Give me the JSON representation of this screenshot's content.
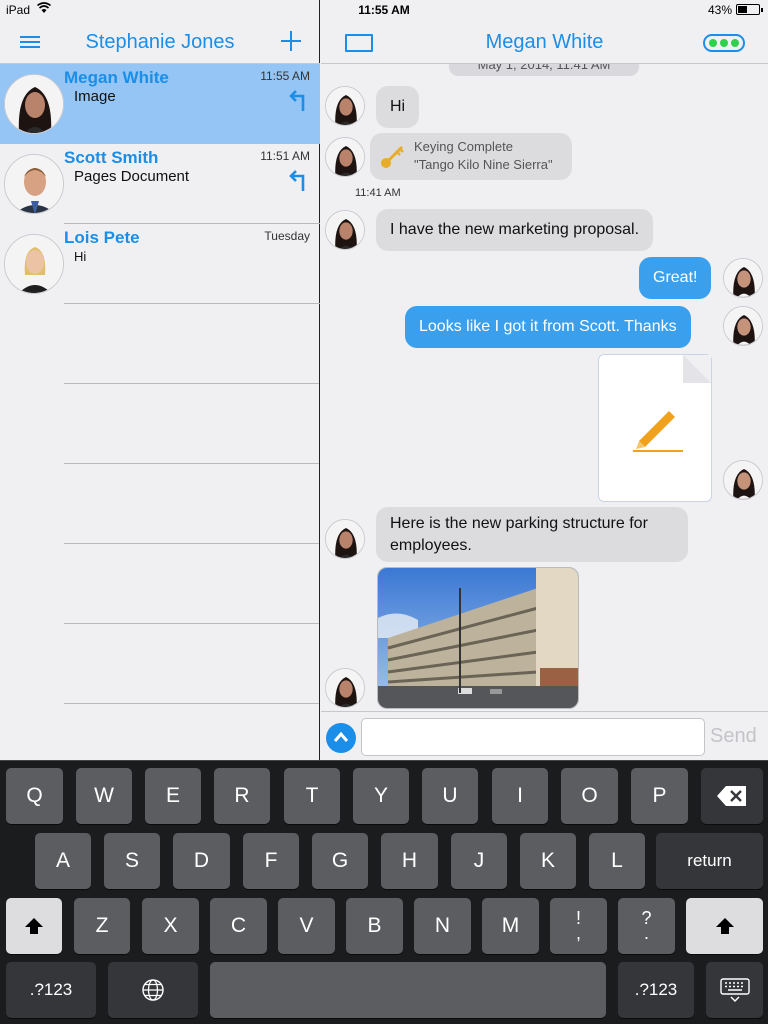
{
  "status": {
    "device": "iPad",
    "time": "11:55 AM",
    "battery": "43%"
  },
  "left": {
    "title": "Stephanie Jones",
    "conversations": [
      {
        "name": "Megan White",
        "time": "11:55 AM",
        "preview": "Image",
        "selected": true
      },
      {
        "name": "Scott Smith",
        "time": "11:51 AM",
        "preview": "Pages Document",
        "selected": false
      },
      {
        "name": "Lois Pete",
        "time": "Tuesday",
        "preview": "Hi",
        "selected": false
      }
    ]
  },
  "chat": {
    "title": "Megan White",
    "date_header": "May 1, 2014, 11:41 AM",
    "messages": [
      {
        "type": "in",
        "text": "Hi"
      },
      {
        "type": "system",
        "title": "Keying Complete",
        "subtitle": "\"Tango Kilo Nine Sierra\""
      },
      {
        "type": "timestamp",
        "text": "11:41 AM"
      },
      {
        "type": "in",
        "text": "I have the new marketing proposal."
      },
      {
        "type": "out",
        "text": "Great!"
      },
      {
        "type": "out",
        "text": "Looks like I got it from Scott. Thanks"
      },
      {
        "type": "out-document"
      },
      {
        "type": "in",
        "text": "Here is the new parking structure for employees."
      },
      {
        "type": "in-image"
      }
    ],
    "composer": {
      "placeholder": "",
      "value": "",
      "send_label": "Send"
    }
  },
  "keyboard": {
    "row1": [
      "Q",
      "W",
      "E",
      "R",
      "T",
      "Y",
      "U",
      "I",
      "O",
      "P"
    ],
    "row2": [
      "A",
      "S",
      "D",
      "F",
      "G",
      "H",
      "J",
      "K",
      "L"
    ],
    "row3": [
      "Z",
      "X",
      "C",
      "V",
      "B",
      "N",
      "M",
      "!\n,",
      "?\n."
    ],
    "return_label": "return",
    "numbers_label": ".?123"
  }
}
